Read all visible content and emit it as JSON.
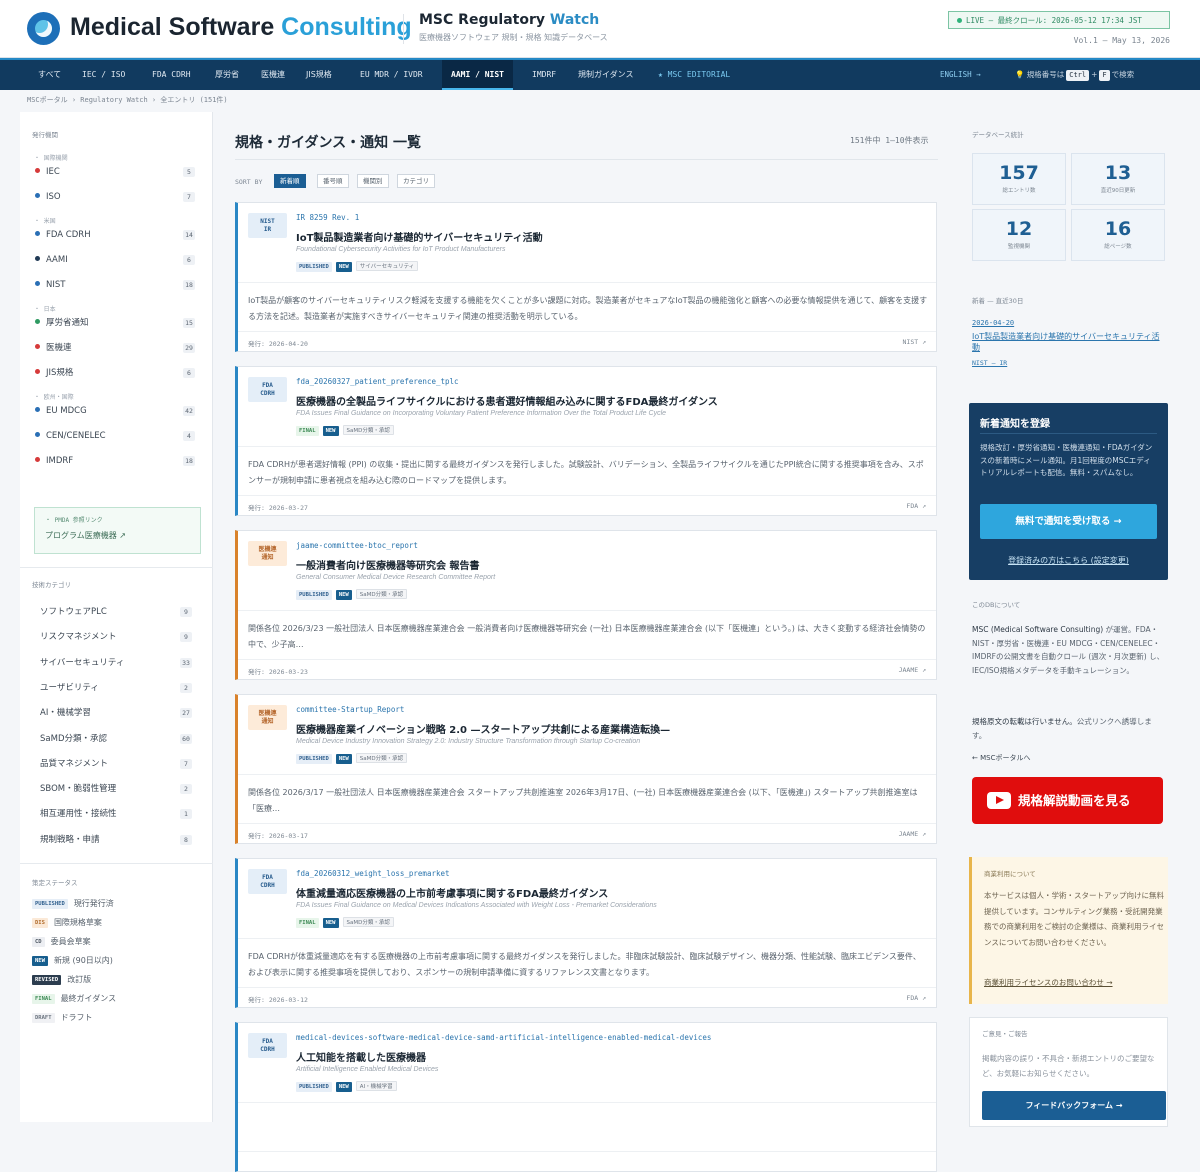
{
  "header": {
    "logo_main": "Medical Software ",
    "logo_accent": "Consulting",
    "site_title_main": "MSC Regulatory ",
    "site_title_accent": "Watch",
    "site_subtitle": "医療機器ソフトウェア 規制・規格 知識データベース",
    "live_status": "LIVE — 最終クロール: 2026-05-12 17:34 JST",
    "volume": "Vol.1 — May 13, 2026"
  },
  "nav": {
    "items": [
      "すべて",
      "IEC / ISO",
      "FDA CDRH",
      "厚労省",
      "医機連",
      "JIS規格",
      "EU MDR / IVDR",
      "AAMI / NIST",
      "IMDRF",
      "規制ガイダンス"
    ],
    "active_index": 7,
    "editorial": "★ MSC EDITORIAL",
    "english": "ENGLISH →",
    "tip_prefix": "💡 規格番号は",
    "kbd1": "Ctrl",
    "plus": "+",
    "kbd2": "F",
    "tip_suffix": "で検索"
  },
  "breadcrumb": "MSCポータル › Regulatory Watch › 全エントリ (151件)",
  "left_sidebar": {
    "publisher_heading": "発行機関",
    "groups": [
      {
        "label": "・ 国際機関",
        "items": [
          {
            "name": "IEC",
            "count": "5",
            "color": "#d63a3a"
          },
          {
            "name": "ISO",
            "count": "7",
            "color": "#2a6fb5"
          }
        ]
      },
      {
        "label": "・ 米国",
        "items": [
          {
            "name": "FDA CDRH",
            "count": "14",
            "color": "#2a6fb5"
          },
          {
            "name": "AAMI",
            "count": "6",
            "color": "#203a55"
          },
          {
            "name": "NIST",
            "count": "18",
            "color": "#2a6fb5"
          }
        ]
      },
      {
        "label": "・ 日本",
        "items": [
          {
            "name": "厚労省通知",
            "count": "15",
            "color": "#2f9a62"
          },
          {
            "name": "医機連",
            "count": "29",
            "color": "#d63a3a"
          },
          {
            "name": "JIS規格",
            "count": "6",
            "color": "#d63a3a"
          }
        ]
      },
      {
        "label": "・ 欧州・国際",
        "items": [
          {
            "name": "EU MDCG",
            "count": "42",
            "color": "#2a6fb5"
          },
          {
            "name": "CEN/CENELEC",
            "count": "4",
            "color": "#2a6fb5"
          },
          {
            "name": "IMDRF",
            "count": "18",
            "color": "#d63a3a"
          }
        ]
      }
    ],
    "pmda_title": "・ PMDA 参照リンク",
    "pmda_link": "プログラム医療機器 ↗",
    "category_heading": "技術カテゴリ",
    "categories": [
      {
        "name": "ソフトウェアPLC",
        "count": "9"
      },
      {
        "name": "リスクマネジメント",
        "count": "9"
      },
      {
        "name": "サイバーセキュリティ",
        "count": "33"
      },
      {
        "name": "ユーザビリティ",
        "count": "2"
      },
      {
        "name": "AI・機械学習",
        "count": "27"
      },
      {
        "name": "SaMD分類・承認",
        "count": "60"
      },
      {
        "name": "品質マネジメント",
        "count": "7"
      },
      {
        "name": "SBOM・脆弱性管理",
        "count": "2"
      },
      {
        "name": "相互運用性・接続性",
        "count": "1"
      },
      {
        "name": "規制戦略・申請",
        "count": "8"
      }
    ],
    "status_heading": "策定ステータス",
    "statuses": [
      {
        "badge": "PUBLISHED",
        "label": "現行発行済",
        "cls": "b-pub"
      },
      {
        "badge": "DIS",
        "label": "国際規格草案",
        "cls": "b-dis"
      },
      {
        "badge": "CD",
        "label": "委員会草案",
        "cls": "b-cd"
      },
      {
        "badge": "NEW",
        "label": "新規 (90日以内)",
        "cls": "b-new"
      },
      {
        "badge": "REVISED",
        "label": "改訂版",
        "cls": "b-rev"
      },
      {
        "badge": "FINAL",
        "label": "最終ガイダンス",
        "cls": "b-fin"
      },
      {
        "badge": "DRAFT",
        "label": "ドラフト",
        "cls": "b-dra"
      }
    ]
  },
  "main": {
    "title": "規格・ガイダンス・通知 一覧",
    "result_count": "151件中 1–10件表示",
    "sort_label": "SORT BY",
    "sort_options": [
      "新着順",
      "番号順",
      "機関別",
      "カテゴリ"
    ],
    "cards": [
      {
        "code": "NIST\nIR",
        "code_type": "us",
        "id": "IR 8259 Rev. 1",
        "title": "IoT製品製造業者向け基礎的サイバーセキュリティ活動",
        "subtitle": "Foundational Cybersecurity Activities for IoT Product Manufacturers",
        "badges": [
          {
            "text": "PUBLISHED",
            "cls": "b-pub"
          },
          {
            "text": "NEW",
            "cls": "b-new"
          },
          {
            "text": "サイバーセキュリティ",
            "cls": "b-tag"
          }
        ],
        "desc": "IoT製品が顧客のサイバーセキュリティリスク軽減を支援する機能を欠くことが多い課題に対応。製造業者がセキュアなIoT製品の機能強化と顧客への必要な情報提供を通じて、顧客を支援する方法を記述。製造業者が実施すべきサイバーセキュリティ関連の推奨活動を明示している。",
        "date": "発行: 2026-04-20",
        "source": "NIST ↗"
      },
      {
        "code": "FDA\nCDRH",
        "code_type": "us",
        "id": "fda_20260327_patient_preference_tplc",
        "title": "医療機器の全製品ライフサイクルにおける患者選好情報組み込みに関するFDA最終ガイダンス",
        "subtitle": "FDA Issues Final Guidance on Incorporating Voluntary Patient Preference Information Over the Total Product Life Cycle",
        "badges": [
          {
            "text": "FINAL",
            "cls": "b-fin"
          },
          {
            "text": "NEW",
            "cls": "b-new"
          },
          {
            "text": "SaMD分類・承認",
            "cls": "b-tag"
          }
        ],
        "desc": "FDA CDRHが患者選好情報 (PPI) の収集・提出に関する最終ガイダンスを発行しました。試験設計、バリデーション、全製品ライフサイクルを通じたPPI統合に関する推奨事項を含み、スポンサーが規制申請に患者視点を組み込む際のロードマップを提供します。",
        "date": "発行: 2026-03-27",
        "source": "FDA ↗"
      },
      {
        "code": "医機連\n通知",
        "code_type": "jp",
        "id": "jaame-committee-btoc_report",
        "title": "一般消費者向け医療機器等研究会 報告書",
        "subtitle": "General Consumer Medical Device Research Committee Report",
        "badges": [
          {
            "text": "PUBLISHED",
            "cls": "b-pub"
          },
          {
            "text": "NEW",
            "cls": "b-new"
          },
          {
            "text": "SaMD分類・承認",
            "cls": "b-tag"
          }
        ],
        "desc": "関係各位 2026/3/23 一般社団法人 日本医療機器産業連合会 一般消費者向け医療機器等研究会 (一社) 日本医療機器産業連合会 (以下「医機連」という。) は、大きく変動する経済社会情勢の中で、少子高…",
        "date": "発行: 2026-03-23",
        "source": "JAAME ↗"
      },
      {
        "code": "医機連\n通知",
        "code_type": "jp",
        "id": "committee-Startup_Report",
        "title": "医療機器産業イノベーション戦略 2.0 —スタートアップ共創による産業構造転換—",
        "subtitle": "Medical Device Industry Innovation Strategy 2.0: Industry Structure Transformation through Startup Co-creation",
        "badges": [
          {
            "text": "PUBLISHED",
            "cls": "b-pub"
          },
          {
            "text": "NEW",
            "cls": "b-new"
          },
          {
            "text": "SaMD分類・承認",
            "cls": "b-tag"
          }
        ],
        "desc": "関係各位 2026/3/17 一般社団法人 日本医療機器産業連合会 スタートアップ共創推進室 2026年3月17日、(一社) 日本医療機器産業連合会 (以下、「医機連」) スタートアップ共創推進室は「医療…",
        "date": "発行: 2026-03-17",
        "source": "JAAME ↗"
      },
      {
        "code": "FDA\nCDRH",
        "code_type": "us",
        "id": "fda_20260312_weight_loss_premarket",
        "title": "体重減量適応医療機器の上市前考慮事項に関するFDA最終ガイダンス",
        "subtitle": "FDA Issues Final Guidance on Medical Devices Indications Associated with Weight Loss - Premarket Considerations",
        "badges": [
          {
            "text": "FINAL",
            "cls": "b-fin"
          },
          {
            "text": "NEW",
            "cls": "b-new"
          },
          {
            "text": "SaMD分類・承認",
            "cls": "b-tag"
          }
        ],
        "desc": "FDA CDRHが体重減量適応を有する医療機器の上市前考慮事項に関する最終ガイダンスを発行しました。非臨床試験設計、臨床試験デザイン、機器分類、性能試験、臨床エビデンス要件、および表示に関する推奨事項を提供しており、スポンサーの規制申請準備に資するリファレンス文書となります。",
        "date": "発行: 2026-03-12",
        "source": "FDA ↗"
      },
      {
        "code": "FDA\nCDRH",
        "code_type": "us",
        "id": "medical-devices-software-medical-device-samd-artificial-intelligence-enabled-medical-devices",
        "title": "人工知能を搭載した医療機器",
        "subtitle": "Artificial Intelligence Enabled Medical Devices",
        "badges": [
          {
            "text": "PUBLISHED",
            "cls": "b-pub"
          },
          {
            "text": "NEW",
            "cls": "b-new"
          },
          {
            "text": "AI・機械学習",
            "cls": "b-tag"
          }
        ],
        "desc": "",
        "date": "",
        "source": ""
      }
    ]
  },
  "right_sidebar": {
    "stats_heading": "データベース統計",
    "stats": [
      {
        "num": "157",
        "label": "総エントリ数"
      },
      {
        "num": "13",
        "label": "直近90日更新"
      },
      {
        "num": "12",
        "label": "監視機関"
      },
      {
        "num": "16",
        "label": "総ページ数"
      }
    ],
    "new_heading": "新着 — 直近30日",
    "new_date": "2026-04-20",
    "new_title": "IoT製品製造業者向け基礎的サイバーセキュリティ活動",
    "new_source": "NIST — IR",
    "notify_title": "新着通知を登録",
    "notify_desc": "規格改訂・厚労省通知・医機連通知・FDAガイダンスの新着時にメール通知。月1回程度のMSCエディトリアルレポートも配信。無料・スパムなし。",
    "notify_button": "無料で通知を受け取る →",
    "notify_link": "登録済みの方はこちら (設定変更)",
    "about_heading": "このDBについて",
    "about_p1_b": "MSC (Medical Software Consulting)",
    "about_p1": " が運営。FDA・NIST・厚労省・医機連・EU MDCG・CEN/CENELEC・IMDRFの公開文書を自動クロール (週次・月次更新) し、IEC/ISO規格メタデータを手動キュレーション。",
    "about_p2_b": "規格原文の転載は行いません。",
    "about_p2": "公式リンクへ誘導します。",
    "portal_link": "← MSCポータルへ",
    "youtube_button": "規格解説動画を見る",
    "commercial_heading": "商業利用について",
    "commercial_desc": "本サービスは個人・学術・スタートアップ向けに無料提供しています。コンサルティング業務・受託開発業務での商業利用をご検討の企業様は、商業利用ライセンスについてお問い合わせください。",
    "commercial_link": "商業利用ライセンスのお問い合わせ →",
    "feedback_heading": "ご意見・ご報告",
    "feedback_desc": "掲載内容の誤り・不具合・新規エントリのご要望など、お気軽にお知らせください。",
    "feedback_button": "フィードバックフォーム →"
  }
}
